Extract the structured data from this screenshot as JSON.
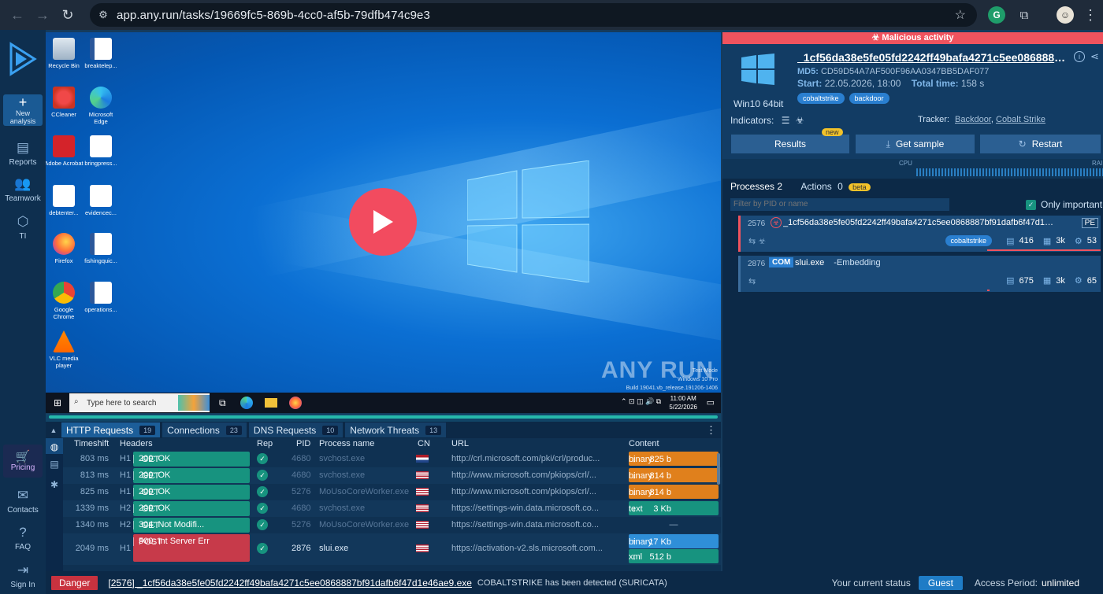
{
  "browser": {
    "url": "app.any.run/tasks/19669fc5-869b-4cc0-af5b-79dfb474c9e3"
  },
  "sidebar": {
    "new_analysis": "New analysis",
    "reports": "Reports",
    "teamwork": "Teamwork",
    "ti": "TI",
    "pricing": "Pricing",
    "contacts": "Contacts",
    "faq": "FAQ",
    "sign_in": "Sign In"
  },
  "desktop": {
    "icons": [
      {
        "label": "Recycle Bin",
        "icon": "recycle-bin-icon"
      },
      {
        "label": "breaktelep...",
        "icon": "word-doc-icon"
      },
      {
        "label": "CCleaner",
        "icon": "ccleaner-icon"
      },
      {
        "label": "Microsoft Edge",
        "icon": "edge-icon"
      },
      {
        "label": "Adobe Acrobat",
        "icon": "acrobat-icon"
      },
      {
        "label": "bringpress...",
        "icon": "doc-icon"
      },
      {
        "label": "debtenter...",
        "icon": "doc-icon"
      },
      {
        "label": "evidencec...",
        "icon": "doc-icon"
      },
      {
        "label": "Firefox",
        "icon": "firefox-icon"
      },
      {
        "label": "fishingquic...",
        "icon": "word-doc-icon"
      },
      {
        "label": "Google Chrome",
        "icon": "chrome-icon"
      },
      {
        "label": "operations...",
        "icon": "word-doc-icon"
      },
      {
        "label": "VLC media player",
        "icon": "vlc-icon"
      }
    ],
    "watermark_brand": "ANY RUN",
    "watermark_line1": "Test Mode",
    "watermark_line2": "Windows 10 Pro",
    "watermark_line3": "Build 19041.vb_release.191206-1406",
    "taskbar_search": "Type here to search",
    "clock_time": "11:00 AM",
    "clock_date": "5/22/2026"
  },
  "network": {
    "tabs": [
      {
        "label": "HTTP Requests",
        "count": "19"
      },
      {
        "label": "Connections",
        "count": "23"
      },
      {
        "label": "DNS Requests",
        "count": "10"
      },
      {
        "label": "Network Threats",
        "count": "13"
      }
    ],
    "columns": {
      "timeshift": "Timeshift",
      "headers": "Headers",
      "rep": "Rep",
      "pid": "PID",
      "process": "Process name",
      "cn": "CN",
      "url": "URL",
      "content": "Content"
    },
    "rows": [
      {
        "ts": "803 ms",
        "hv": "H1",
        "method": "GET",
        "status": "200: OK",
        "pid": "4680",
        "process": "svchost.exe",
        "cn": "nl",
        "url": "http://crl.microsoft.com/pki/crl/produc...",
        "content": [
          {
            "size": "825 b",
            "dir": "down",
            "type": "binary",
            "color": "#e0801c"
          }
        ]
      },
      {
        "ts": "813 ms",
        "hv": "H1",
        "method": "GET",
        "status": "200: OK",
        "pid": "4680",
        "process": "svchost.exe",
        "cn": "us",
        "url": "http://www.microsoft.com/pkiops/crl/...",
        "content": [
          {
            "size": "814 b",
            "dir": "down",
            "type": "binary",
            "color": "#e0801c"
          }
        ]
      },
      {
        "ts": "825 ms",
        "hv": "H1",
        "method": "GET",
        "status": "200: OK",
        "pid": "5276",
        "process": "MoUsoCoreWorker.exe",
        "cn": "us",
        "url": "http://www.microsoft.com/pkiops/crl/...",
        "content": [
          {
            "size": "814 b",
            "dir": "down",
            "type": "binary",
            "color": "#e0801c"
          }
        ]
      },
      {
        "ts": "1339 ms",
        "hv": "H2",
        "method": "GET",
        "status": "200: OK",
        "pid": "4680",
        "process": "svchost.exe",
        "cn": "us",
        "url": "https://settings-win.data.microsoft.co...",
        "content": [
          {
            "size": "3 Kb",
            "dir": "down",
            "type": "text",
            "color": "#17937f"
          }
        ]
      },
      {
        "ts": "1340 ms",
        "hv": "H2",
        "method": "GET",
        "status": "304: Not Modifi...",
        "pid": "5276",
        "process": "MoUsoCoreWorker.exe",
        "cn": "us",
        "url": "https://settings-win.data.microsoft.co...",
        "content": "—"
      },
      {
        "ts": "2049 ms",
        "hv": "H1",
        "method": "POST",
        "status": "500: Int Server Err",
        "pid": "2876",
        "process": "slui.exe",
        "cn": "us",
        "url": "https://activation-v2.sls.microsoft.com...",
        "content": [
          {
            "size": "17 Kb",
            "dir": "up",
            "type": "binary",
            "color": "#2f8fd8"
          },
          {
            "size": "512 b",
            "dir": "down",
            "type": "xml",
            "color": "#17937f"
          }
        ]
      }
    ]
  },
  "bottombar": {
    "badge": "Danger",
    "file": "[2576] _1cf56da38e5fe05fd2242ff49bafa4271c5ee0868887bf91dafb6f47d1e46ae9.exe",
    "message": "COBALTSTRIKE has been detected (SURICATA)",
    "status_label": "Your current status",
    "status_value": "Guest",
    "access_label": "Access Period:",
    "access_value": "unlimited"
  },
  "report": {
    "banner": "Malicious activity",
    "os": "Win10 64bit",
    "filename": "_1cf56da38e5fe05fd2242ff49bafa4271c5ee0868887bf91dafb6f47d1e46ae9.exe",
    "md5_label": "MD5:",
    "md5": "CD59D54A7AF500F96AA0347BB5DAF077",
    "start_label": "Start:",
    "start": "22.05.2026, 18:00",
    "total_label": "Total time:",
    "total": "158 s",
    "tags": [
      "cobaltstrike",
      "backdoor"
    ],
    "indicators_label": "Indicators:",
    "tracker_label": "Tracker:",
    "trackers": [
      "Backdoor",
      "Cobalt Strike"
    ],
    "buttons": {
      "results": "Results",
      "get_sample": "Get sample",
      "restart": "Restart"
    },
    "new_badge": "new",
    "cpu_label": "CPU",
    "ram_label": "RAI",
    "processes_label": "Processes",
    "processes_count": "2",
    "actions_label": "Actions",
    "actions_count": "0",
    "beta_badge": "beta",
    "filter_placeholder": "Filter by PID or name",
    "only_important": "Only important",
    "processes": [
      {
        "pid": "2576",
        "name": "_1cf56da38e5fe05fd2242ff49bafa4271c5ee0868887bf91dafb6f47d1e46ae9.exe",
        "type": "PE",
        "tag": "cobaltstrike",
        "files": "416",
        "reg": "3k",
        "mods": "53"
      },
      {
        "pid": "2876",
        "badge": "COM",
        "name": "slui.exe",
        "args": "-Embedding",
        "files": "675",
        "reg": "3k",
        "mods": "65"
      }
    ]
  },
  "colors": {
    "accent": "#1c5e99",
    "malicious": "#f0535e",
    "ok": "#17937f",
    "error": "#c73a4a",
    "binary": "#e0801c"
  }
}
